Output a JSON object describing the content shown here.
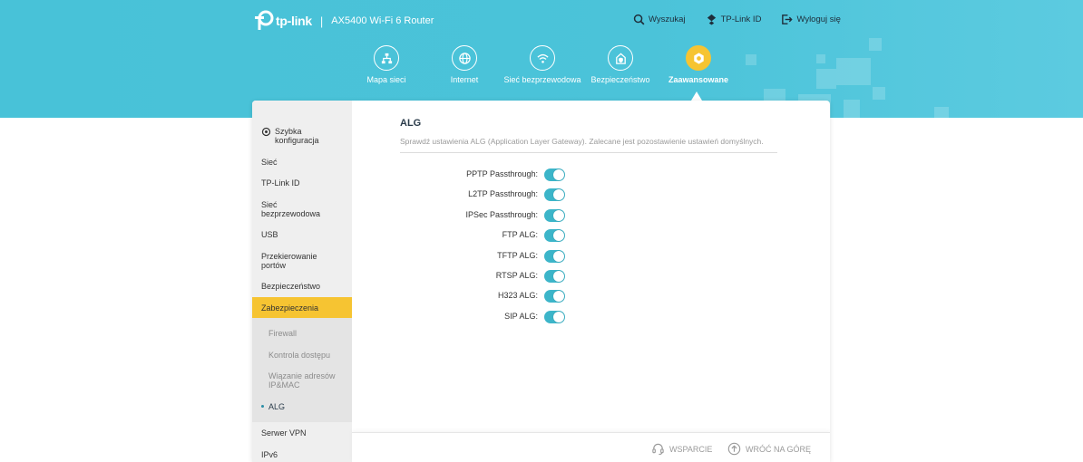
{
  "brand": {
    "logo_text": "tp-link",
    "separator": "|",
    "model": "AX5400 Wi-Fi 6 Router"
  },
  "toplinks": [
    {
      "label": "Wyszukaj",
      "icon": "search-icon"
    },
    {
      "label": "TP-Link ID",
      "icon": "tplink-id-icon"
    },
    {
      "label": "Wyloguj się",
      "icon": "logout-icon"
    }
  ],
  "nav": [
    {
      "label": "Mapa sieci",
      "icon": "network-map-icon",
      "active": false
    },
    {
      "label": "Internet",
      "icon": "globe-icon",
      "active": false
    },
    {
      "label": "Sieć bezprzewodowa",
      "icon": "wifi-icon",
      "active": false
    },
    {
      "label": "Bezpieczeństwo",
      "icon": "home-shield-icon",
      "active": false
    },
    {
      "label": "Zaawansowane",
      "icon": "gear-icon",
      "active": true
    }
  ],
  "sidebar": {
    "items": [
      {
        "label": "Szybka konfiguracja",
        "icon": "quick-setup-icon"
      },
      {
        "label": "Sieć"
      },
      {
        "label": "TP-Link ID"
      },
      {
        "label": "Sieć bezprzewodowa"
      },
      {
        "label": "USB"
      },
      {
        "label": "Przekierowanie portów"
      },
      {
        "label": "Bezpieczeństwo"
      },
      {
        "label": "Zabezpieczenia",
        "active": true
      },
      {
        "label": "Serwer VPN"
      },
      {
        "label": "IPv6"
      }
    ],
    "subitems": [
      {
        "label": "Firewall"
      },
      {
        "label": "Kontrola dostępu"
      },
      {
        "label": "Wiązanie adresów IP&MAC"
      },
      {
        "label": "ALG",
        "current": true
      }
    ]
  },
  "main": {
    "title": "ALG",
    "description": "Sprawdź ustawienia ALG (Application Layer Gateway). Zalecane jest pozostawienie ustawień domyślnych.",
    "settings": [
      {
        "label": "PPTP Passthrough:",
        "enabled": true
      },
      {
        "label": "L2TP Passthrough:",
        "enabled": true
      },
      {
        "label": "IPSec Passthrough:",
        "enabled": true
      },
      {
        "label": "FTP ALG:",
        "enabled": true
      },
      {
        "label": "TFTP ALG:",
        "enabled": true
      },
      {
        "label": "RTSP ALG:",
        "enabled": true
      },
      {
        "label": "H323 ALG:",
        "enabled": true
      },
      {
        "label": "SIP ALG:",
        "enabled": true
      }
    ]
  },
  "footer": {
    "support": "WSPARCIE",
    "back_to_top": "WRÓĆ NA GÓRĘ"
  },
  "colors": {
    "header": "#48c2d8",
    "accent": "#f6c432",
    "toggle_on": "#3cb5c9"
  }
}
